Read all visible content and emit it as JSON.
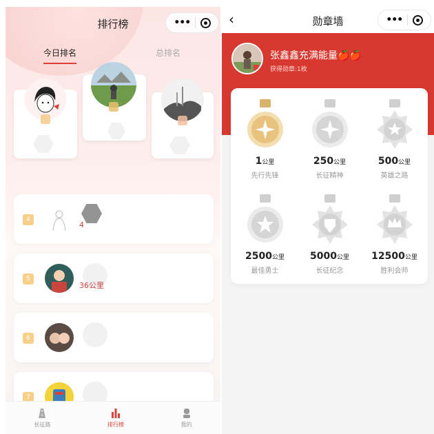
{
  "leaderboard": {
    "title": "排行榜",
    "tabs": [
      "今日排名",
      "总排名"
    ],
    "rows": [
      {
        "rank": "4",
        "distance": "4"
      },
      {
        "rank": "5",
        "distance": "36公里"
      },
      {
        "rank": "6",
        "distance": ""
      },
      {
        "rank": "7",
        "distance": ""
      }
    ],
    "tabbar": [
      {
        "label": "长征路",
        "icon": "road-icon"
      },
      {
        "label": "排行榜",
        "icon": "bar-chart-icon"
      },
      {
        "label": "我的",
        "icon": "user-icon"
      }
    ]
  },
  "medal_wall": {
    "title": "勋章墙",
    "user_name": "张鑫鑫充满能量🍎🍎",
    "medal_count": "获得勋章:1枚",
    "unit": "公里",
    "medals": [
      {
        "value": "1",
        "name": "先行先锋",
        "earned": true
      },
      {
        "value": "250",
        "name": "长征精神",
        "earned": false
      },
      {
        "value": "500",
        "name": "英雄之路",
        "earned": false
      },
      {
        "value": "2500",
        "name": "最佳勇士",
        "earned": false
      },
      {
        "value": "5000",
        "name": "长征纪念",
        "earned": false
      },
      {
        "value": "12500",
        "name": "胜利会师",
        "earned": false
      }
    ]
  },
  "colors": {
    "accent": "#d9413a",
    "gold": "#e8c27e",
    "silver": "#c9c9c9"
  }
}
